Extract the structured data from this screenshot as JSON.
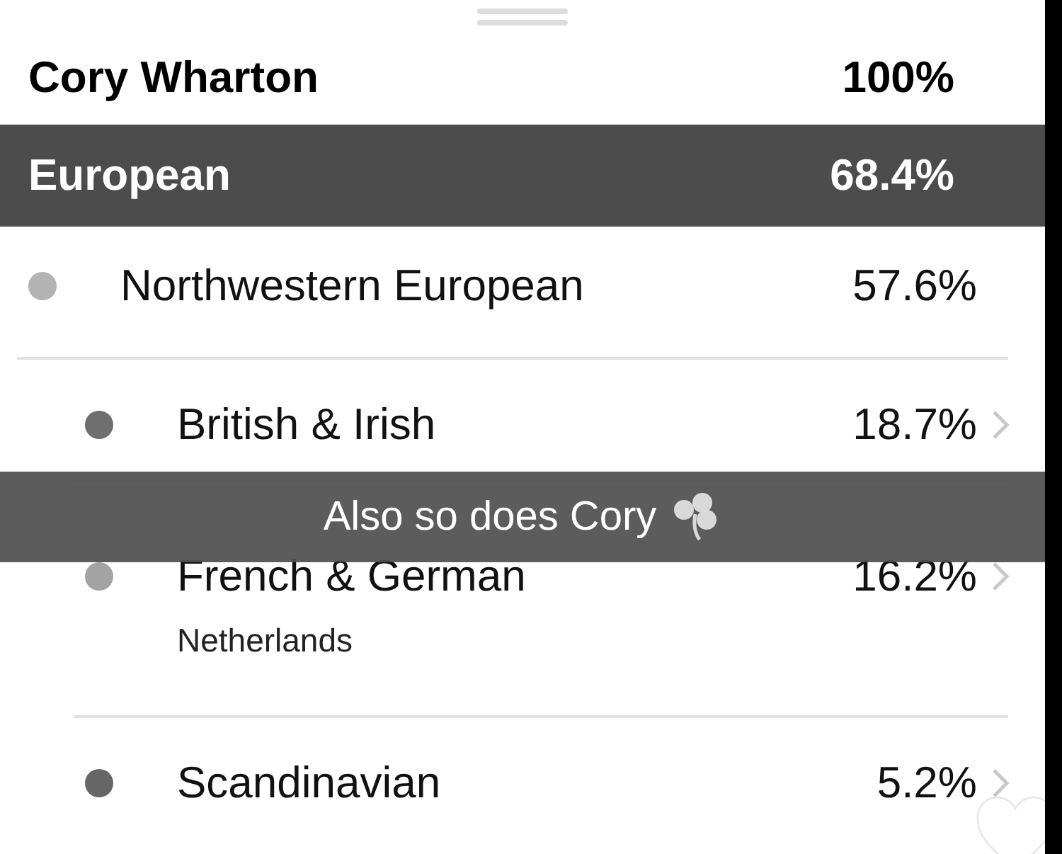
{
  "header": {
    "name": "Cory Wharton",
    "percent": "100%"
  },
  "region": {
    "name": "European",
    "percent": "68.4%",
    "children": [
      {
        "name": "Northwestern European",
        "percent": "57.6%",
        "color": "#b3b3b3",
        "chevron": false,
        "children": [
          {
            "name": "British & Irish",
            "percent": "18.7%",
            "color": "#6f6f6f",
            "chevron": true
          },
          {
            "name": "French & German",
            "percent": "16.2%",
            "color": "#a3a3a3",
            "chevron": true,
            "note": "Netherlands"
          },
          {
            "name": "Scandinavian",
            "percent": "5.2%",
            "color": "#666666",
            "chevron": true
          }
        ]
      }
    ]
  },
  "caption": {
    "text": "Also so does Cory"
  }
}
